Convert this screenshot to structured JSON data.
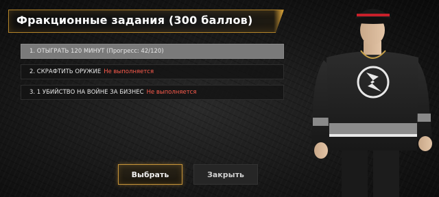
{
  "header": {
    "title": "Фракционные задания (300 баллов)"
  },
  "tasks": [
    {
      "text": "1. ОТЫГРАТЬ 120 МИНУТ (Прогресс: 42/120)",
      "status": "",
      "selected": true
    },
    {
      "text": "2. СКРАФТИТЬ ОРУЖИЕ",
      "status": "Не выполняется",
      "selected": false
    },
    {
      "text": "3. 1 УБИЙСТВО НА ВОЙНЕ ЗА БИЗНЕС",
      "status": "Не выполняется",
      "selected": false
    }
  ],
  "buttons": {
    "select_label": "Выбрать",
    "close_label": "Закрыть"
  },
  "colors": {
    "accent_gold": "#c8953a",
    "status_red": "#ff5c4d",
    "selected_row": "#7a7a7a"
  }
}
